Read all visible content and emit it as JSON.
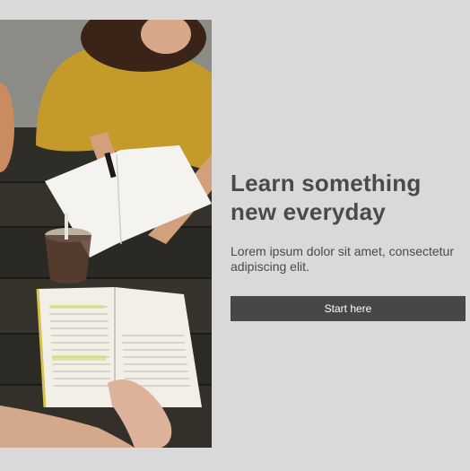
{
  "hero": {
    "headline": "Learn something new everyday",
    "body": "Lorem ipsum dolor sit amet, consectetur adipiscing elit.",
    "cta_label": "Start here"
  },
  "colors": {
    "background": "#d9d9d9",
    "text": "#4a4a4a",
    "button": "#474747",
    "button_text": "#ffffff"
  }
}
